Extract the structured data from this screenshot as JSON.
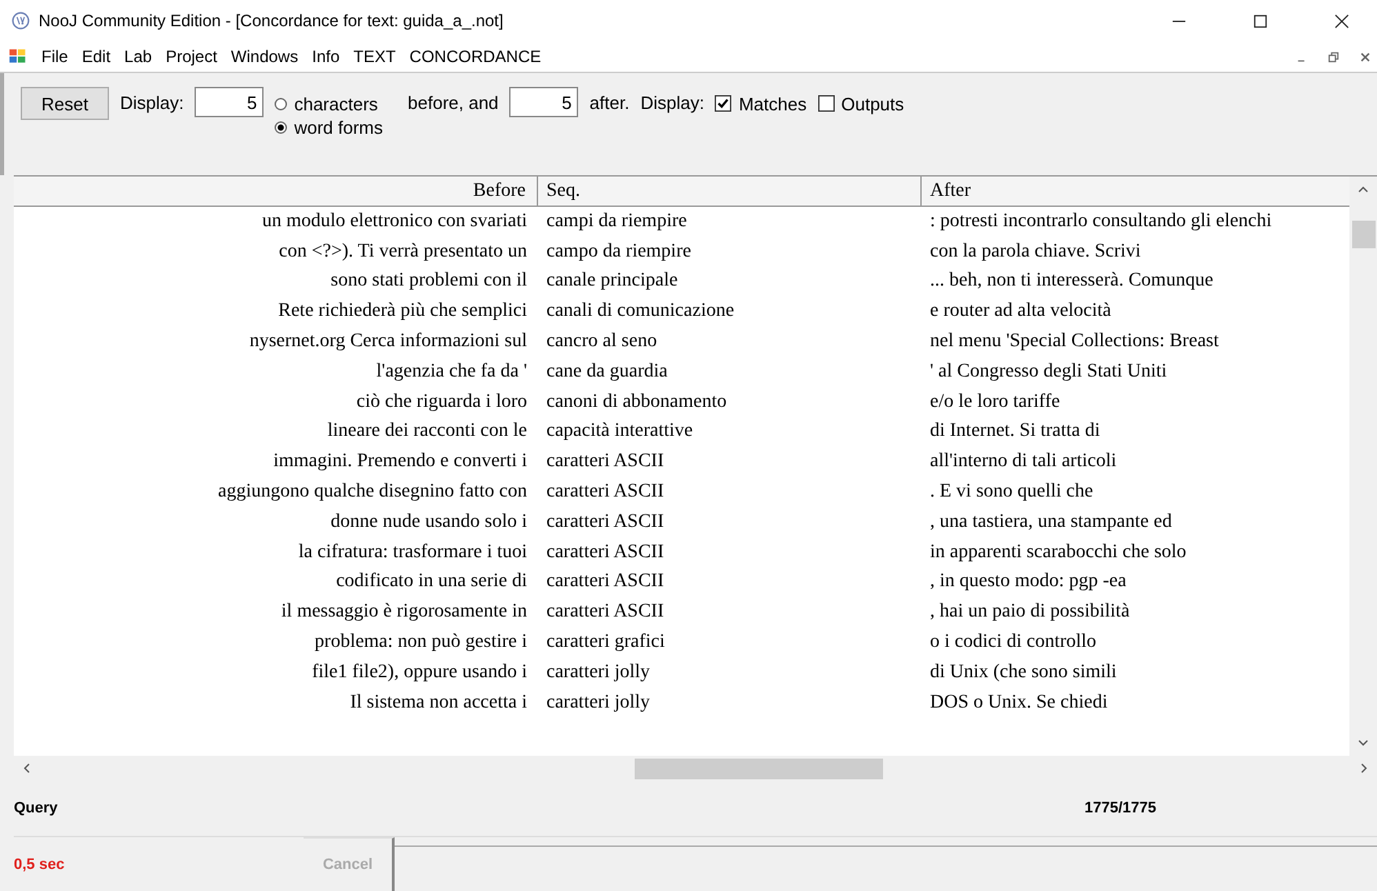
{
  "window": {
    "title": "NooJ Community Edition - [Concordance for text: guida_a_.not]"
  },
  "menu": [
    {
      "label": "File"
    },
    {
      "label": "Edit"
    },
    {
      "label": "Lab"
    },
    {
      "label": "Project"
    },
    {
      "label": "Windows"
    },
    {
      "label": "Info"
    },
    {
      "label": "TEXT"
    },
    {
      "label": "CONCORDANCE"
    }
  ],
  "toolbar": {
    "reset": "Reset",
    "display_label": "Display:",
    "before_value": "5",
    "units": [
      {
        "label": "characters",
        "selected": false
      },
      {
        "label": "word forms",
        "selected": true
      }
    ],
    "before_and": "before, and",
    "after_value": "5",
    "after_label": "after.",
    "display_label_2": "Display:",
    "options": [
      {
        "label": "Matches",
        "checked": true
      },
      {
        "label": "Outputs",
        "checked": false
      }
    ]
  },
  "table": {
    "columns": [
      "Before",
      "Seq.",
      "After"
    ],
    "rows": [
      [
        "un modulo elettronico con svariati",
        "campi da riempire",
        ": potresti incontrarlo consultando gli elenchi"
      ],
      [
        "con <?>). Ti verrà presentato un",
        "campo da riempire",
        "con la parola chiave. Scrivi"
      ],
      [
        "sono stati problemi con il",
        "canale principale",
        "... beh,  non ti interesserà. Comunque"
      ],
      [
        "Rete richiederà più che semplici",
        "canali di comunicazione",
        "e router ad alta velocità"
      ],
      [
        "nysernet.org  Cerca informazioni sul",
        "cancro al seno",
        "nel menu 'Special Collections: Breast"
      ],
      [
        "l'agenzia che fa da '",
        "cane da guardia",
        "' al Congresso degli Stati Uniti"
      ],
      [
        "ciò che riguarda i loro",
        "canoni di abbonamento",
        "e/o le loro tariffe"
      ],
      [
        "lineare dei racconti con le",
        "capacità interattive",
        "di Internet. Si tratta di"
      ],
      [
        "immagini. Premendo e converti i",
        "caratteri ASCII",
        "all'interno di tali articoli"
      ],
      [
        "aggiungono qualche disegnino fatto con",
        "caratteri ASCII",
        ". E vi sono quelli che"
      ],
      [
        "donne nude usando solo i",
        "caratteri ASCII",
        ", una tastiera, una stampante ed"
      ],
      [
        "la cifratura: trasformare i tuoi",
        "caratteri ASCII",
        "in apparenti scarabocchi che solo"
      ],
      [
        "codificato in una serie di",
        "caratteri ASCII",
        ", in questo modo:    pgp -ea"
      ],
      [
        "il messaggio è rigorosamente in",
        "caratteri ASCII",
        ", hai un paio di possibilità"
      ],
      [
        "problema: non può gestire i",
        "caratteri grafici",
        "o i codici di controllo"
      ],
      [
        "file1 file2), oppure usando i",
        "caratteri jolly",
        "di Unix (che sono simili"
      ],
      [
        "Il sistema non accetta i",
        "caratteri jolly",
        "DOS o Unix. Se chiedi"
      ]
    ]
  },
  "query": {
    "label": "Query",
    "count": "1775/1775"
  },
  "status": {
    "time": "0,5 sec",
    "cancel": "Cancel"
  }
}
